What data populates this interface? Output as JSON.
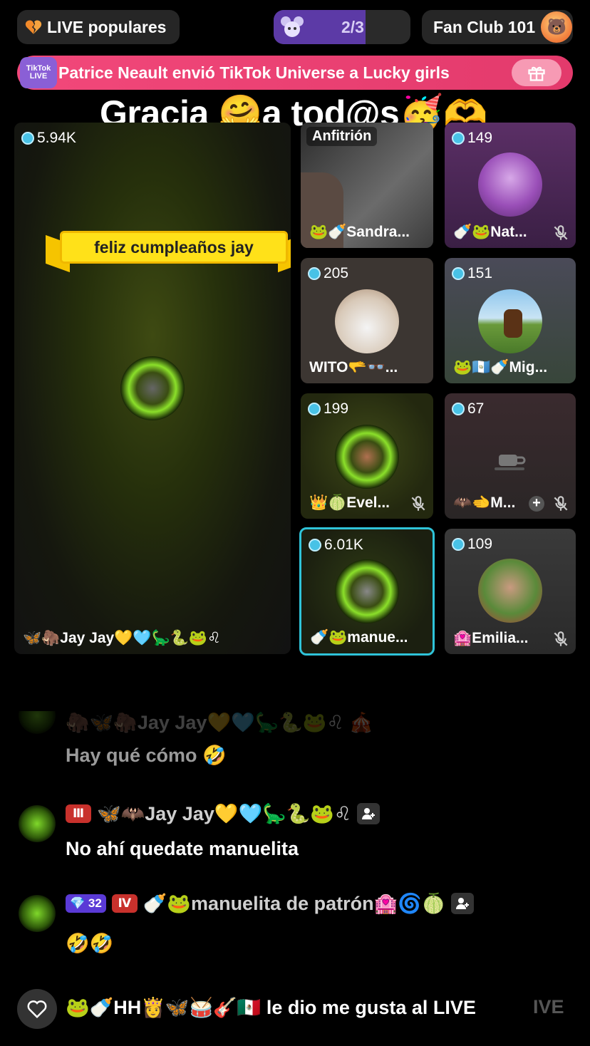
{
  "topbar": {
    "live_popular": "LIVE populares",
    "page": "2/3",
    "page_progress": 0.67,
    "fan_club": "Fan Club 101"
  },
  "banner": {
    "logo_text": "TikTok LIVE",
    "text": "Patrice Neault envió TikTok Universe a Lucky girls"
  },
  "title": "Gracia 🤗a tod@s🥳🫶",
  "host_label": "Anfitrión",
  "ribbon": "feliz cumpleaños jay",
  "tiles": [
    {
      "coins": "5.94K",
      "name": "🦋🦣Jay Jay💛🩵🦕🐍🐸♌"
    },
    {
      "coins": "",
      "name": "🐸🍼Sandra..."
    },
    {
      "coins": "149",
      "name": "🍼🐸Nat..."
    },
    {
      "coins": "205",
      "name": "WITO🫳👓..."
    },
    {
      "coins": "151",
      "name": "🐸🇬🇹🍼Mig..."
    },
    {
      "coins": "199",
      "name": "👑🍈Evel..."
    },
    {
      "coins": "67",
      "name": "🦇🫲M..."
    },
    {
      "coins": "6.01K",
      "name": "🍼🐸manue..."
    },
    {
      "coins": "109",
      "name": "🏩Emilia..."
    }
  ],
  "chat": {
    "faded_name": "🦣🦋🦣Jay Jay💛🩵🦕🐍🐸♌ 🎪",
    "msg0": "Hay qué cómo 🤣",
    "user1_name": "🦋🦇Jay Jay💛🩵🦕🐍🐸♌",
    "user1_level": "Ⅲ",
    "msg1": "No ahí quedate manuelita",
    "user2_badge": "32",
    "user2_level": "Ⅳ",
    "user2_name": "🍼🐸manuelita de patrón🏩🌀🍈",
    "msg2": "🤣🤣",
    "like_line": "🐸🍼HH👸🦋🥁🎸🇲🇽 le dio me gusta al LIVE",
    "like_ghost": "IVE"
  },
  "colors": {
    "accent_pink": "#e63e70",
    "progress_purple": "#5c3aa6",
    "coin_blue": "#48c2e6",
    "selected_border": "#2fc3d9"
  }
}
